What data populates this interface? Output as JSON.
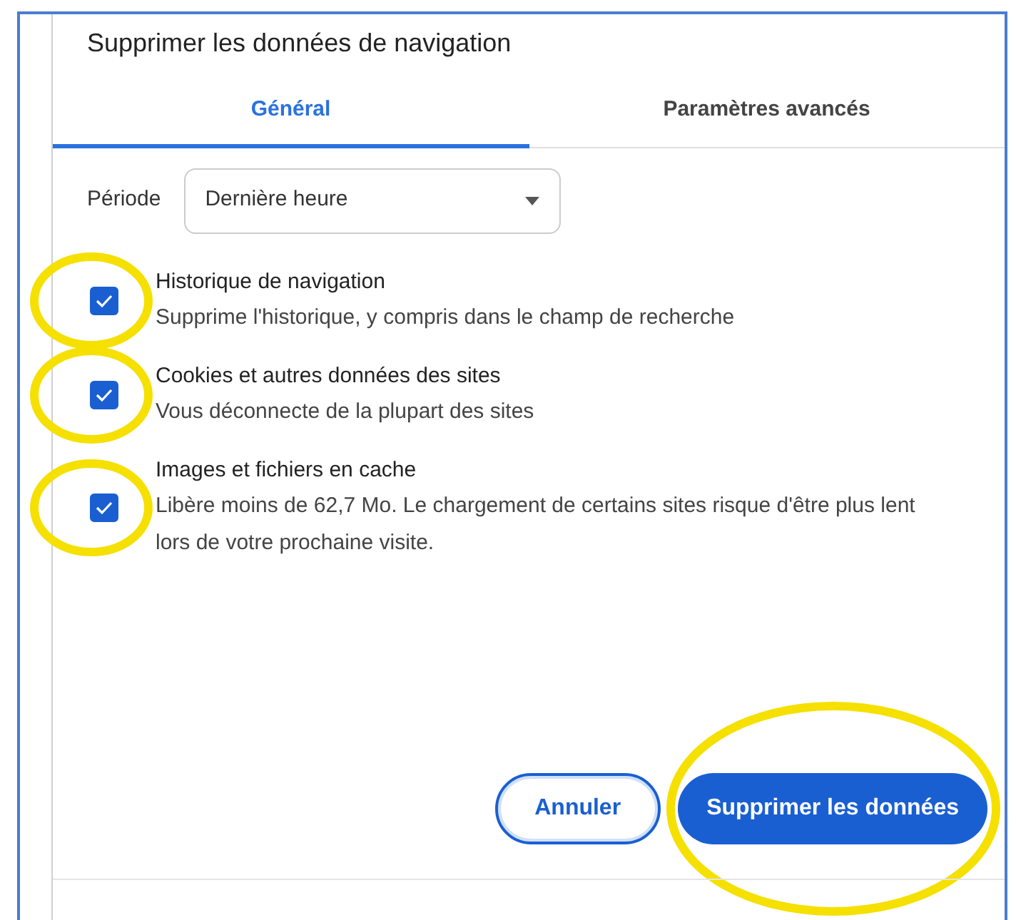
{
  "dialog": {
    "title": "Supprimer les données de navigation"
  },
  "tabs": [
    {
      "label": "Général",
      "selected": true
    },
    {
      "label": "Paramètres avancés",
      "selected": false
    }
  ],
  "period": {
    "label": "Période",
    "value": "Dernière heure"
  },
  "options": [
    {
      "title": "Historique de navigation",
      "description": "Supprime l'historique, y compris dans le champ de recherche",
      "checked": true,
      "highlighted": true
    },
    {
      "title": "Cookies et autres données des sites",
      "description": "Vous déconnecte de la plupart des sites",
      "checked": true,
      "highlighted": true
    },
    {
      "title": "Images et fichiers en cache",
      "description": "Libère moins de 62,7 Mo. Le chargement de certains sites risque d'être plus lent lors de votre prochaine visite.",
      "checked": true,
      "highlighted": true
    }
  ],
  "buttons": [
    {
      "label": "Annuler",
      "kind": "secondary",
      "highlighted": false
    },
    {
      "label": "Supprimer les données",
      "kind": "primary",
      "highlighted": true
    }
  ]
}
